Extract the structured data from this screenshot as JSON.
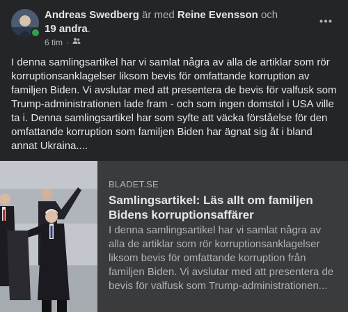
{
  "header": {
    "author": "Andreas Swedberg",
    "with_word": "är med",
    "tagged": "Reine Evensson",
    "and_word": "och",
    "others": "19 andra",
    "period": ".",
    "time": "6 tim",
    "separator": "·",
    "audience_icon": "friends-icon",
    "more_icon": "more-horizontal-icon"
  },
  "post": {
    "text": "I denna samlingsartikel har vi samlat några av alla de artiklar som rör korruptionsanklagelser liksom bevis för omfattande korruption av familjen Biden. Vi avslutar med att presentera de bevis för valfusk som Trump-administrationen lade fram - och som ingen domstol i USA ville ta i. Denna samlingsartikel har som syfte att väcka förståelse för den omfattande korruption som familjen Biden har ägnat sig åt i bland annat Ukraina...."
  },
  "link_preview": {
    "domain": "BLADET.SE",
    "title": "Samlingsartikel: Läs allt om familjen Bidens korruptionsaffärer",
    "description": "I denna samlingsartikel har vi samlat några av alla de artiklar som rör korruptionsanklagelser liksom bevis för omfattande korruption från familjen Biden. Vi avslutar med att presentera de bevis för valfusk som Trump-administrationen..."
  },
  "colors": {
    "background": "#242526",
    "preview_background": "#3a3b3c",
    "primary_text": "#e4e6eb",
    "secondary_text": "#b0b3b8",
    "online": "#31a24c"
  }
}
